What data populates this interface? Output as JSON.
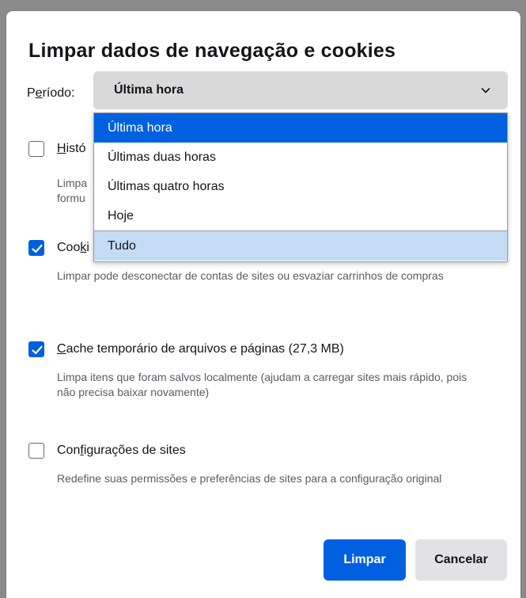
{
  "dialog": {
    "title": "Limpar dados de navegação e cookies"
  },
  "period": {
    "label_prefix": "P",
    "label_underlined": "e",
    "label_suffix": "ríodo:",
    "selected_value": "Última hora",
    "options": [
      {
        "label": "Última hora",
        "state": "selected"
      },
      {
        "label": "Últimas duas horas",
        "state": "normal"
      },
      {
        "label": "Últimas quatro horas",
        "state": "normal"
      },
      {
        "label": "Hoje",
        "state": "normal"
      },
      {
        "label": "Tudo",
        "state": "hover"
      }
    ]
  },
  "items": [
    {
      "label_visible": "Histó",
      "label_underline_char": "H",
      "checked": false,
      "desc_visible_line1": "Limpa",
      "desc_visible_line2": "formu"
    },
    {
      "label_visible": "Cooki",
      "label_underline_char": "k",
      "checked": true,
      "description": "Limpar pode desconectar de contas de sites ou esvaziar carrinhos de compras"
    },
    {
      "label": "Cache temporário de arquivos e páginas (27,3 MB)",
      "label_underline_char": "C",
      "checked": true,
      "description": "Limpa itens que foram salvos localmente (ajudam a carregar sites mais rápido, pois não precisa baixar novamente)"
    },
    {
      "label": "Configurações de sites",
      "label_underline_char": "f",
      "checked": false,
      "description": "Redefine suas permissões e preferências de sites para a configuração original"
    }
  ],
  "buttons": {
    "clear": "Limpar",
    "cancel": "Cancelar"
  },
  "colors": {
    "accent": "#0060df",
    "select_bg": "#d9d9d9",
    "hover_option": "#c4dbf6",
    "secondary_button": "#e2e2e5",
    "description_text": "#5b5b66"
  },
  "icons": {
    "select_chevron": "chevron-down-icon",
    "checkbox_mark": "checkmark-icon"
  }
}
